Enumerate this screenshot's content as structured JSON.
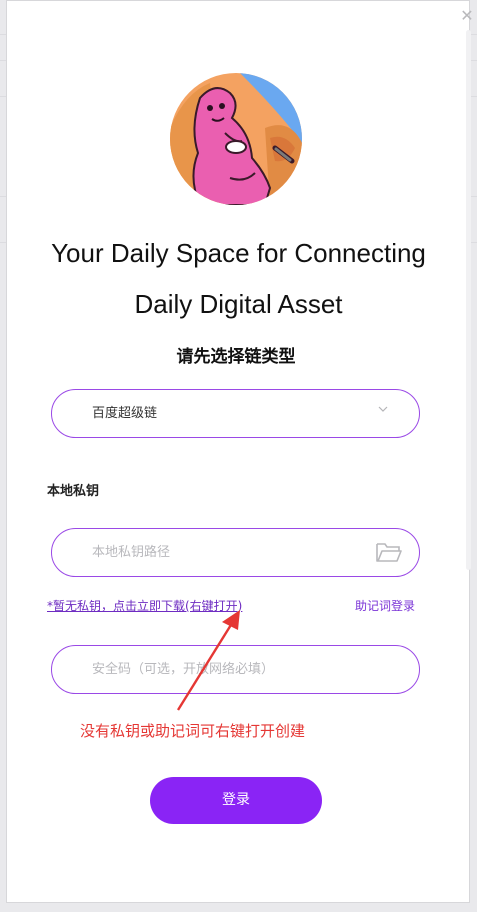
{
  "header": {
    "close_symbol": "✕",
    "avatar_icon": "illustrated-character-avatar"
  },
  "hero": {
    "title_line1": "Your Daily Space for Connecting",
    "title_line2": "Daily Digital Asset"
  },
  "chain": {
    "prompt": "请先选择链类型",
    "selected": "百度超级链",
    "icon": "chevron-down-icon"
  },
  "private_key": {
    "label": "本地私钥",
    "placeholder": "本地私钥路径",
    "icon": "folder-icon"
  },
  "links": {
    "download": "*暂无私钥，点击立即下载(右键打开)",
    "mnemonic_login": "助记词登录"
  },
  "security": {
    "placeholder": "安全码（可选，开放网络必填）"
  },
  "annotation": {
    "text": "没有私钥或助记词可右键打开创建",
    "color": "#e53734"
  },
  "actions": {
    "login_label": "登录"
  },
  "colors": {
    "accent": "#8a24f5",
    "field_border": "#9a49e6"
  }
}
